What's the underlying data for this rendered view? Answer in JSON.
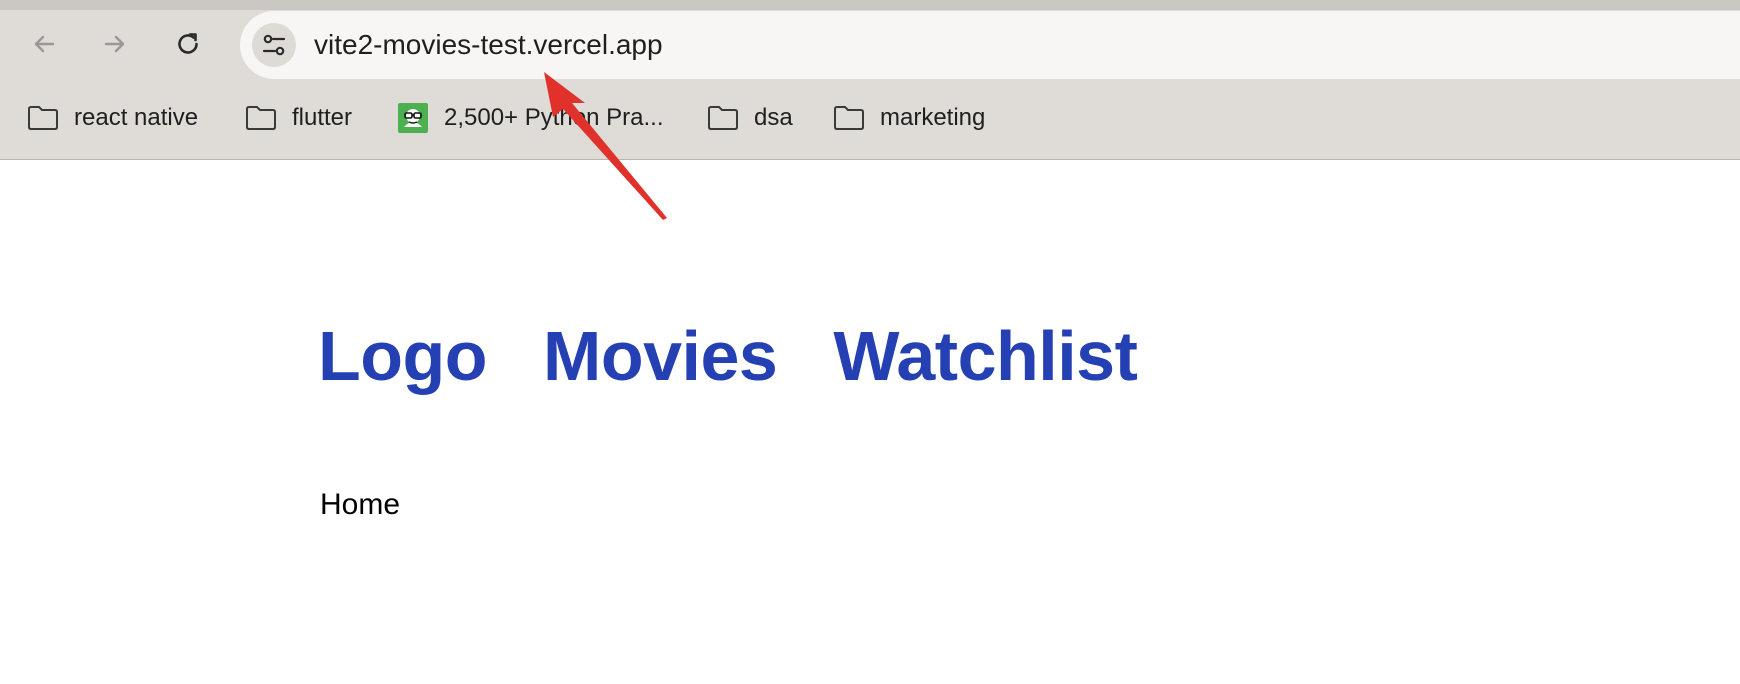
{
  "browser": {
    "url": "vite2-movies-test.vercel.app",
    "bookmarks": [
      {
        "label": "react native",
        "icon": "folder-icon"
      },
      {
        "label": "flutter",
        "icon": "folder-icon"
      },
      {
        "label": "2,500+ Python Pra...",
        "icon": "favicon-glasses-icon"
      },
      {
        "label": "dsa",
        "icon": "folder-icon"
      },
      {
        "label": "marketing",
        "icon": "folder-icon"
      }
    ]
  },
  "site": {
    "nav": {
      "logo": "Logo",
      "movies": "Movies",
      "watchlist": "Watchlist"
    },
    "body_text": "Home"
  },
  "colors": {
    "nav_link": "#2540b3",
    "annotation_arrow": "#e0322b",
    "chrome_background": "#dfdcd8"
  }
}
